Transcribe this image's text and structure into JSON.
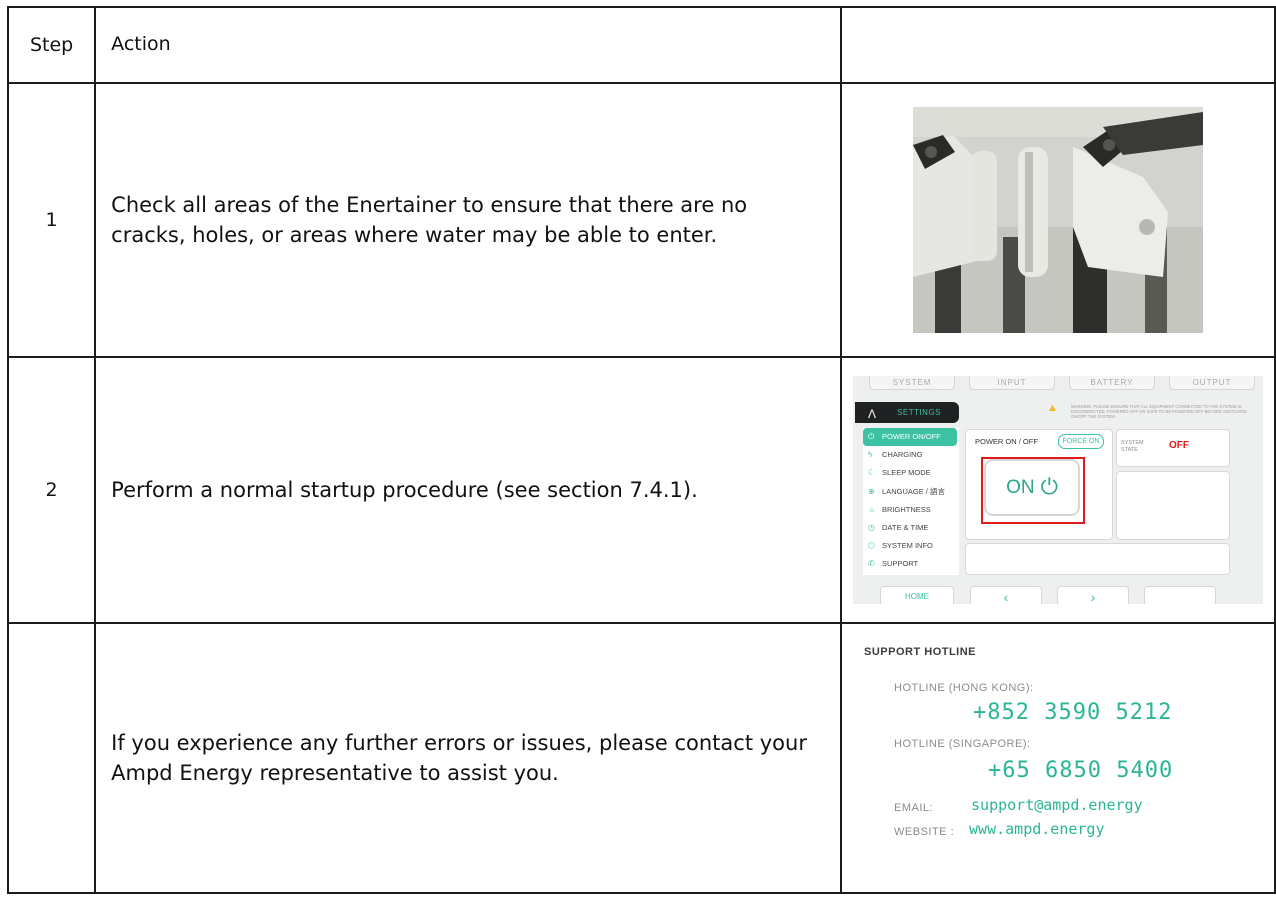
{
  "header": {
    "step": "Step",
    "action": "Action",
    "image": ""
  },
  "rows": [
    {
      "step": "1",
      "action": "Check all areas of the Enertainer to ensure that there are no cracks, holes, or areas where water may be able to enter."
    },
    {
      "step": "2",
      "action": "Perform a normal startup procedure (see section 7.4.1)."
    },
    {
      "step": "",
      "action": "If you experience any further errors or issues, please contact your Ampd Energy representative to assist you."
    }
  ],
  "settings_screen": {
    "top_tabs": [
      "SYSTEM",
      "INPUT",
      "BATTERY",
      "OUTPUT"
    ],
    "logo": "Λ",
    "header": "SETTINGS",
    "warning": "WARNING: PLEASE ENSURE THAT ALL EQUIPMENT CONNECTED TO THE SYSTEM IS DISCONNECTED, POWERED OFF OR SAFE TO BE POWERED OFF BEFORE SWITCHING ON/OFF THE SYSTEM.",
    "menu": [
      {
        "icon": "⏻",
        "label": "POWER ON/OFF"
      },
      {
        "icon": "ϟ",
        "label": "CHARGING"
      },
      {
        "icon": "☾",
        "label": "SLEEP MODE"
      },
      {
        "icon": "⊕",
        "label": "LANGUAGE / 語言"
      },
      {
        "icon": "☼",
        "label": "BRIGHTNESS"
      },
      {
        "icon": "◷",
        "label": "DATE & TIME"
      },
      {
        "icon": "⬡",
        "label": "SYSTEM INFO"
      },
      {
        "icon": "✆",
        "label": "SUPPORT"
      }
    ],
    "power_label": "POWER ON / OFF",
    "force_on": "FORCE ON",
    "on_button": "ON",
    "power_icon": "⏻",
    "system_state_label": "SYSTEM STATE",
    "system_state_value": "OFF",
    "bottom_tabs": {
      "home": "HOME",
      "prev": "‹",
      "next": "›"
    },
    "accent": "#3cc2a3",
    "highlight": "#e11b1b"
  },
  "support": {
    "title": "SUPPORT HOTLINE",
    "hk_label": "HOTLINE (HONG KONG):",
    "hk_number": "+852 3590 5212",
    "sg_label": "HOTLINE (SINGAPORE):",
    "sg_number": "+65 6850 5400",
    "email_label": "EMAIL:",
    "email": "support@ampd.energy",
    "website_label": "WEBSITE :",
    "website": "www.ampd.energy",
    "accent": "#2bb596"
  }
}
